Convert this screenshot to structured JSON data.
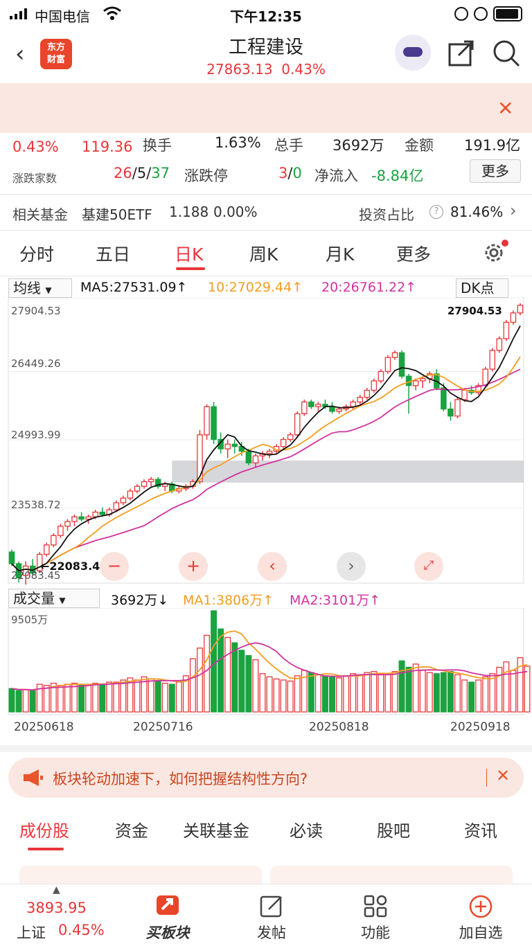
{
  "status_bar": {
    "carrier": "中国电信",
    "time": "下午12:35"
  },
  "header": {
    "logo_text": "东方\n财富",
    "title": "工程建设",
    "price": "27863.13",
    "change_pct": "0.43%"
  },
  "stats": {
    "row1": {
      "change_pct": "0.43%",
      "change_amt": "119.36",
      "turnover_label": "换手",
      "turnover": "1.63%",
      "volume_label": "总手",
      "volume": "3692万",
      "amount_label": "金额",
      "amount": "191.9亿"
    },
    "row2": {
      "advdec_label": "涨跌家数",
      "adv": "26",
      "flat": "5",
      "dec": "37",
      "limit_label": "涨跌停",
      "limit_up": "3",
      "limit_down": "0",
      "netflow_label": "净流入",
      "netflow": "-8.84亿",
      "more_button": "更多"
    },
    "fund": {
      "label": "相关基金",
      "name": "基建50ETF",
      "price": "1.188",
      "change": "0.00%",
      "ratio_label": "投资占比",
      "ratio": "81.46%"
    }
  },
  "period_tabs": [
    "分时",
    "五日",
    "日K",
    "周K",
    "月K",
    "更多"
  ],
  "kline_legend": {
    "dropdown": "均线",
    "ma5": "MA5:27531.09↑",
    "ma10": "10:27029.44↑",
    "ma20": "20:26761.22↑",
    "dk_button": "DK点"
  },
  "kline_axis": [
    "27904.53",
    "26449.26",
    "24993.99",
    "23538.72",
    "22083.45"
  ],
  "kline_marks": {
    "high": "27904.53",
    "low": "←22083.45"
  },
  "volume_legend": {
    "dropdown": "成交量",
    "vol": "3692万↓",
    "ma1": "MA1:3806万↑",
    "ma2": "MA2:3101万↑"
  },
  "volume_axis_max": "9505万",
  "dates": [
    "20250618",
    "20250716",
    "20250818",
    "20250918"
  ],
  "notice": {
    "text": "板块轮动加速下，如何把握结构性方向?"
  },
  "bottom_tabs": [
    "成份股",
    "资金",
    "关联基金",
    "必读",
    "股吧",
    "资讯"
  ],
  "nav": {
    "index_value": "3893.95",
    "index_name": "上证",
    "index_change": "0.45%",
    "buy_label": "买板块",
    "post_label": "发帖",
    "function_label": "功能",
    "watch_label": "加自选"
  },
  "colors": {
    "up": "#e8363a",
    "down": "#1aa340",
    "ma5": "#111111",
    "ma10": "#f39d1e",
    "ma20": "#d1329e",
    "accent": "#e8363a"
  },
  "chart_data": {
    "type": "candlestick",
    "ylim": [
      22083.45,
      27904.53
    ],
    "ohlc": [
      [
        22600,
        22650,
        22300,
        22350
      ],
      [
        22350,
        22400,
        21950,
        22050
      ],
      [
        22100,
        22400,
        21900,
        22300
      ],
      [
        22300,
        22450,
        22100,
        22150
      ],
      [
        22200,
        22600,
        22150,
        22550
      ],
      [
        22550,
        22800,
        22500,
        22750
      ],
      [
        22750,
        23000,
        22700,
        22950
      ],
      [
        22950,
        23200,
        22900,
        23150
      ],
      [
        23150,
        23300,
        23050,
        23250
      ],
      [
        23250,
        23400,
        23150,
        23350
      ],
      [
        23350,
        23450,
        23250,
        23300
      ],
      [
        23300,
        23400,
        23200,
        23350
      ],
      [
        23350,
        23500,
        23300,
        23450
      ],
      [
        23450,
        23550,
        23350,
        23400
      ],
      [
        23400,
        23550,
        23350,
        23500
      ],
      [
        23500,
        23700,
        23450,
        23650
      ],
      [
        23650,
        23800,
        23600,
        23750
      ],
      [
        23750,
        23950,
        23700,
        23900
      ],
      [
        23900,
        24050,
        23850,
        24000
      ],
      [
        24000,
        24150,
        23950,
        24100
      ],
      [
        24100,
        24200,
        24000,
        24150
      ],
      [
        24150,
        24200,
        23950,
        24000
      ],
      [
        24000,
        24100,
        23900,
        24050
      ],
      [
        24050,
        24100,
        23850,
        23900
      ],
      [
        23900,
        24000,
        23850,
        23950
      ],
      [
        23950,
        24050,
        23900,
        24000
      ],
      [
        24000,
        24150,
        23950,
        24100
      ],
      [
        24100,
        25200,
        24050,
        25100
      ],
      [
        25100,
        25750,
        25000,
        25700
      ],
      [
        25700,
        25800,
        24900,
        25000
      ],
      [
        25000,
        25150,
        24700,
        24800
      ],
      [
        24800,
        25000,
        24600,
        24900
      ],
      [
        24900,
        25000,
        24700,
        24850
      ],
      [
        24850,
        24950,
        24650,
        24750
      ],
      [
        24750,
        24800,
        24450,
        24500
      ],
      [
        24500,
        24700,
        24400,
        24650
      ],
      [
        24650,
        24750,
        24550,
        24700
      ],
      [
        24700,
        24800,
        24600,
        24750
      ],
      [
        24750,
        24900,
        24700,
        24850
      ],
      [
        24850,
        25050,
        24800,
        25000
      ],
      [
        25000,
        25150,
        24950,
        25100
      ],
      [
        25100,
        25600,
        25050,
        25550
      ],
      [
        25550,
        25850,
        25500,
        25800
      ],
      [
        25800,
        25850,
        25650,
        25700
      ],
      [
        25700,
        25800,
        25600,
        25750
      ],
      [
        25750,
        25850,
        25650,
        25700
      ],
      [
        25700,
        25800,
        25550,
        25600
      ],
      [
        25600,
        25700,
        25550,
        25650
      ],
      [
        25650,
        25750,
        25600,
        25700
      ],
      [
        25700,
        25850,
        25650,
        25800
      ],
      [
        25800,
        25950,
        25750,
        25900
      ],
      [
        25900,
        26100,
        25850,
        26050
      ],
      [
        26050,
        26300,
        26000,
        26250
      ],
      [
        26250,
        26500,
        26200,
        26450
      ],
      [
        26450,
        26800,
        26400,
        26750
      ],
      [
        26750,
        26900,
        26700,
        26850
      ],
      [
        26850,
        26900,
        26300,
        26350
      ],
      [
        26350,
        26400,
        25550,
        26150
      ],
      [
        26150,
        26300,
        26050,
        26250
      ],
      [
        26250,
        26350,
        26100,
        26300
      ],
      [
        26300,
        26450,
        26200,
        26400
      ],
      [
        26400,
        26500,
        26050,
        26100
      ],
      [
        26100,
        26200,
        25600,
        25650
      ],
      [
        25650,
        25800,
        25400,
        25500
      ],
      [
        25500,
        25900,
        25450,
        25850
      ],
      [
        25850,
        26100,
        25800,
        26050
      ],
      [
        26050,
        26150,
        25950,
        26000
      ],
      [
        26000,
        26200,
        25950,
        26150
      ],
      [
        26150,
        26550,
        26100,
        26500
      ],
      [
        26500,
        26950,
        26450,
        26900
      ],
      [
        26900,
        27200,
        26850,
        27150
      ],
      [
        27150,
        27550,
        27100,
        27500
      ],
      [
        27500,
        27750,
        27450,
        27700
      ],
      [
        27700,
        27904.53,
        27650,
        27863.13
      ]
    ],
    "volume_max_wan": 9505,
    "volume_wan": [
      2200,
      2000,
      2100,
      2000,
      2600,
      2500,
      2700,
      2500,
      2600,
      2700,
      2500,
      2600,
      2700,
      2600,
      2800,
      2800,
      3000,
      3200,
      3000,
      3300,
      3100,
      2900,
      2700,
      2600,
      2800,
      3400,
      5000,
      6000,
      7200,
      9505,
      7800,
      7000,
      6500,
      5800,
      5300,
      4900,
      3600,
      3300,
      3100,
      3000,
      2900,
      3400,
      3900,
      3700,
      3500,
      3400,
      3300,
      3200,
      3400,
      3600,
      3500,
      3700,
      3800,
      3600,
      3500,
      3800,
      4800,
      4200,
      4500,
      3900,
      3700,
      3600,
      3700,
      3800,
      3500,
      3000,
      2800,
      3000,
      3300,
      3600,
      4200,
      4700,
      3900,
      5100,
      4300
    ]
  }
}
